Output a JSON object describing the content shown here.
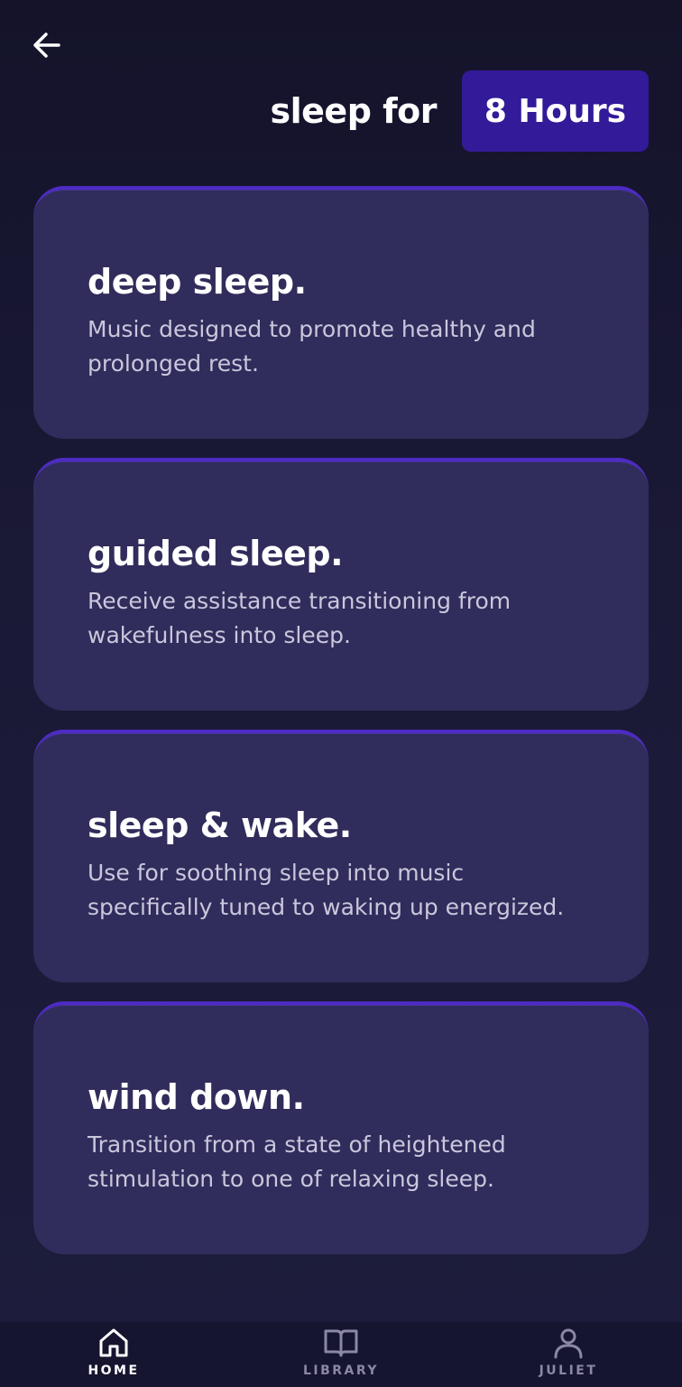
{
  "header": {
    "title": "sleep for",
    "duration": "8 Hours"
  },
  "cards": [
    {
      "title": "deep sleep.",
      "description": "Music designed to promote healthy and prolonged rest."
    },
    {
      "title": "guided sleep.",
      "description": "Receive assistance transitioning from wakefulness into sleep."
    },
    {
      "title": "sleep & wake.",
      "description": "Use for soothing sleep into music specifically tuned to waking up energized."
    },
    {
      "title": "wind down.",
      "description": "Transition from a state of heightened stimulation to one of relaxing sleep."
    }
  ],
  "nav": {
    "items": [
      {
        "label": "HOME",
        "icon": "home-icon",
        "active": true
      },
      {
        "label": "LIBRARY",
        "icon": "book-icon",
        "active": false
      },
      {
        "label": "JULIET",
        "icon": "user-icon",
        "active": false
      }
    ]
  },
  "colors": {
    "background": "#1a1936",
    "card": "#302c5b",
    "card_border": "#4d2bc4",
    "accent_button": "#331a99",
    "nav_inactive": "#8a88a3"
  }
}
